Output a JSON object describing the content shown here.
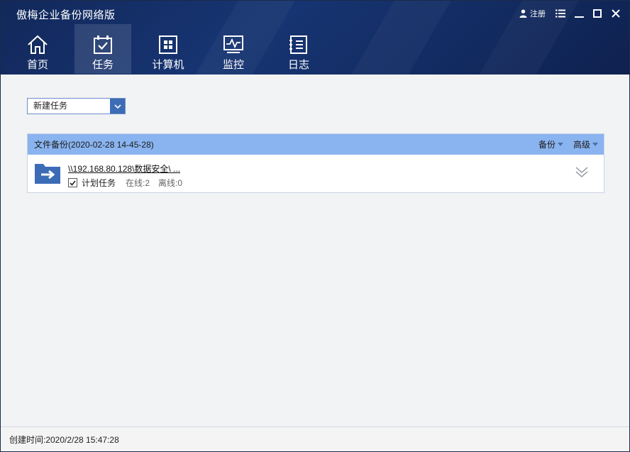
{
  "app": {
    "title": "傲梅企业备份网络版"
  },
  "window_controls": {
    "login_label": "注册",
    "icons": [
      "user-icon",
      "menu-list-icon",
      "minimize-icon",
      "maximize-icon",
      "close-icon"
    ]
  },
  "nav": {
    "tabs": [
      {
        "label": "首页",
        "icon": "home-icon",
        "active": false
      },
      {
        "label": "任务",
        "icon": "task-icon",
        "active": true
      },
      {
        "label": "计算机",
        "icon": "computer-icon",
        "active": false
      },
      {
        "label": "监控",
        "icon": "monitor-icon",
        "active": false
      },
      {
        "label": "日志",
        "icon": "log-icon",
        "active": false
      }
    ]
  },
  "toolbar": {
    "new_task_dropdown": {
      "selected": "新建任务",
      "icon": "chevron-down-icon"
    }
  },
  "task": {
    "header_title": "文件备份(2020-02-28 14-45-28)",
    "backup_menu": "备份",
    "advanced_menu": "高级",
    "path": "\\\\192.168.80.128\\数据安全\\  ...",
    "scheduled_label": "计划任务",
    "scheduled_checked": true,
    "online": "在线:2",
    "offline": "离线:0"
  },
  "status": {
    "created_time": "创建时间:2020/2/28 15:47:28"
  },
  "colors": {
    "header_bg": "#173573",
    "accent": "#3d6cb6",
    "task_header_bg": "#8ab4f0",
    "content_bg": "#f2f3f5"
  }
}
